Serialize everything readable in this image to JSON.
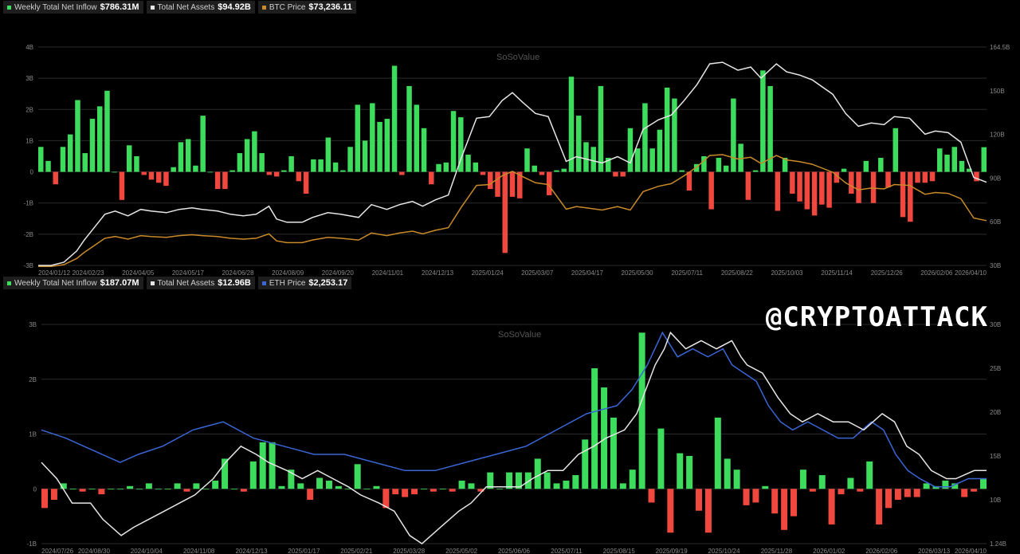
{
  "watermark": "@CRYPTOATTACK",
  "logo": "SoSoValue",
  "colors": {
    "positive": "#3ddc5c",
    "negative": "#f0473f",
    "assets": "#e6e6e6",
    "btc": "#c98a2a",
    "eth": "#3a66d6",
    "grid": "#2a2a2a"
  },
  "chart_data": [
    {
      "type": "bar",
      "legend": [
        {
          "label": "Weekly Total Net Inflow",
          "value": "$786.31M",
          "color": "#3ddc5c"
        },
        {
          "label": "Total Net Assets",
          "value": "$94.92B",
          "color": "#e6e6e6"
        },
        {
          "label": "BTC Price",
          "value": "$73,236.11",
          "color": "#c98a2a"
        }
      ],
      "ylim": [
        -3,
        4
      ],
      "y_ticks": [
        "4B",
        "3B",
        "2B",
        "1B",
        "0",
        "-1B",
        "-2B",
        "-3B"
      ],
      "y2_ticks": [
        "164.5B",
        "150B",
        "120B",
        "90B",
        "60B",
        "30B"
      ],
      "x_ticks": [
        "2024/01/12",
        "2024/02/23",
        "2024/04/05",
        "2024/05/17",
        "2024/06/28",
        "2024/08/09",
        "2024/09/20",
        "2024/11/01",
        "2024/12/13",
        "2025/01/24",
        "2025/03/07",
        "2025/04/17",
        "2025/05/30",
        "2025/07/11",
        "2025/08/22",
        "2025/10/03",
        "2025/11/14",
        "2025/12/26",
        "2026/02/06",
        "2026/04/10"
      ],
      "inflow": [
        0.8,
        0.35,
        -0.4,
        0.8,
        1.2,
        2.3,
        0.6,
        1.7,
        2.1,
        2.6,
        0,
        -0.9,
        0.85,
        0.5,
        -0.1,
        -0.25,
        -0.35,
        -0.45,
        0.15,
        0.95,
        1.05,
        0.2,
        1.8,
        0,
        -0.55,
        -0.55,
        0.05,
        0.6,
        1.05,
        1.3,
        0.6,
        -0.1,
        -0.15,
        0.05,
        0.5,
        -0.3,
        -0.7,
        0.4,
        0.4,
        1.1,
        0.3,
        0.05,
        0.8,
        2.15,
        1,
        2.2,
        1.6,
        1.7,
        3.4,
        -0.1,
        2.75,
        2.15,
        1.4,
        -0.4,
        0.25,
        0.3,
        1.95,
        1.75,
        0.55,
        0.3,
        -0.1,
        -0.55,
        -0.8,
        -2.6,
        -0.8,
        -0.85,
        0.75,
        0.2,
        -0.1,
        -0.75,
        0.05,
        0.1,
        3.05,
        1.8,
        0.95,
        0.8,
        2.75,
        0.45,
        -0.15,
        -0.15,
        1.4,
        0.75,
        2.2,
        0.75,
        1.35,
        2.7,
        2.35,
        0.05,
        -0.6,
        0.25,
        0.5,
        -1.2,
        0.45,
        0.2,
        2.35,
        0.9,
        -0.9,
        0.05,
        3.25,
        2.75,
        -1.25,
        0.45,
        -0.7,
        -0.95,
        -1.2,
        -1.4,
        -1.05,
        -1.15,
        -0.35,
        0.1,
        -0.7,
        -1,
        0.35,
        -1,
        0.45,
        -0.5,
        1.4,
        -1.45,
        -1.6,
        -0.35,
        -0.35,
        -0.3,
        0.75,
        0.55,
        0.8,
        0.35,
        0.1,
        -0.3,
        0.79
      ],
      "assets_pts": [
        [
          0,
          28
        ],
        [
          5,
          28
        ],
        [
          10,
          30
        ],
        [
          15,
          37
        ],
        [
          18,
          44
        ],
        [
          22,
          52
        ],
        [
          26,
          60
        ],
        [
          30,
          62
        ],
        [
          35,
          59
        ],
        [
          40,
          63
        ],
        [
          44,
          62
        ],
        [
          50,
          61
        ],
        [
          55,
          63
        ],
        [
          60,
          64
        ],
        [
          64,
          63
        ],
        [
          70,
          62
        ],
        [
          75,
          60
        ],
        [
          80,
          59
        ],
        [
          85,
          60
        ],
        [
          90,
          65
        ],
        [
          93,
          57
        ],
        [
          97,
          55
        ],
        [
          103,
          55
        ],
        [
          107,
          58
        ],
        [
          113,
          61
        ],
        [
          118,
          60
        ],
        [
          125,
          58
        ],
        [
          130,
          66
        ],
        [
          136,
          63
        ],
        [
          141,
          66
        ],
        [
          146,
          68
        ],
        [
          150,
          65
        ],
        [
          155,
          69
        ],
        [
          160,
          72
        ],
        [
          165,
          95
        ],
        [
          171,
          120
        ],
        [
          176,
          121
        ],
        [
          181,
          131
        ],
        [
          185,
          136
        ],
        [
          189,
          130
        ],
        [
          194,
          123
        ],
        [
          199,
          121
        ],
        [
          206,
          93
        ],
        [
          210,
          96
        ],
        [
          215,
          94
        ],
        [
          220,
          92
        ],
        [
          226,
          96
        ],
        [
          231,
          92
        ],
        [
          236,
          113
        ],
        [
          242,
          119
        ],
        [
          247,
          122
        ],
        [
          252,
          131
        ],
        [
          257,
          141
        ],
        [
          262,
          154
        ],
        [
          267,
          155
        ],
        [
          273,
          150
        ],
        [
          278,
          152
        ],
        [
          282,
          145
        ],
        [
          288,
          154
        ],
        [
          292,
          149
        ],
        [
          297,
          147
        ],
        [
          302,
          144
        ],
        [
          310,
          135
        ],
        [
          315,
          123
        ],
        [
          320,
          115
        ],
        [
          325,
          117
        ],
        [
          330,
          116
        ],
        [
          334,
          121
        ],
        [
          340,
          120
        ],
        [
          346,
          110
        ],
        [
          350,
          112
        ],
        [
          355,
          111
        ],
        [
          360,
          105
        ],
        [
          365,
          83
        ],
        [
          370,
          80
        ]
      ]
    },
    {
      "type": "bar",
      "legend": [
        {
          "label": "Weekly Total Net Inflow",
          "value": "$187.07M",
          "color": "#3ddc5c"
        },
        {
          "label": "Total Net Assets",
          "value": "$12.96B",
          "color": "#e6e6e6"
        },
        {
          "label": "ETH Price",
          "value": "$2,253.17",
          "color": "#3a66d6"
        }
      ],
      "ylim": [
        -1,
        3
      ],
      "y_ticks": [
        "3B",
        "2B",
        "1B",
        "0",
        "-1B"
      ],
      "y2_ticks": [
        "30B",
        "25B",
        "20B",
        "15B",
        "10B",
        "1.24B"
      ],
      "x_ticks": [
        "2024/07/26",
        "2024/08/30",
        "2024/10/04",
        "2024/11/08",
        "2024/12/13",
        "2025/01/17",
        "2025/02/21",
        "2025/03/28",
        "2025/05/02",
        "2025/06/06",
        "2025/07/11",
        "2025/08/15",
        "2025/09/19",
        "2025/10/24",
        "2025/11/28",
        "2026/01/02",
        "2026/02/06",
        "2026/03/13",
        "2026/04/10"
      ],
      "inflow": [
        -0.35,
        -0.2,
        0.1,
        0,
        -0.05,
        0,
        -0.1,
        0,
        0,
        0.05,
        0,
        0.1,
        0,
        0,
        0.1,
        -0.05,
        0.1,
        0,
        0.15,
        0.55,
        0,
        -0.05,
        0.5,
        0.85,
        0.85,
        0.05,
        0.35,
        0.1,
        -0.2,
        0.2,
        0.15,
        0.05,
        0,
        0.45,
        0,
        0.05,
        -0.35,
        -0.1,
        -0.15,
        -0.1,
        0,
        -0.05,
        0,
        -0.05,
        0.15,
        0.1,
        -0.05,
        0.3,
        0,
        0.3,
        0.3,
        0.3,
        0.55,
        0.3,
        0.1,
        0.15,
        0.25,
        0.9,
        2.2,
        1.85,
        1.3,
        0.1,
        0.35,
        2.85,
        -0.25,
        1.1,
        -0.8,
        0.65,
        0.6,
        -0.4,
        -0.8,
        1.3,
        0.55,
        0.35,
        -0.3,
        -0.25,
        0.05,
        -0.45,
        -0.75,
        -0.5,
        0.35,
        -0.05,
        0.25,
        -0.65,
        -0.1,
        0.2,
        -0.05,
        0.5,
        -0.65,
        -0.35,
        -0.2,
        -0.15,
        -0.15,
        0.1,
        0.05,
        0.15,
        0.1,
        -0.15,
        -0.05,
        0.19
      ],
      "assets_pts": [
        [
          0,
          13
        ],
        [
          5,
          11
        ],
        [
          10,
          8
        ],
        [
          16,
          8
        ],
        [
          20,
          6
        ],
        [
          26,
          4
        ],
        [
          30,
          5
        ],
        [
          35,
          6
        ],
        [
          40,
          7
        ],
        [
          45,
          8
        ],
        [
          50,
          9
        ],
        [
          56,
          11
        ],
        [
          60,
          13
        ],
        [
          65,
          15
        ],
        [
          70,
          14
        ],
        [
          74,
          13
        ],
        [
          80,
          12
        ],
        [
          85,
          11
        ],
        [
          90,
          12
        ],
        [
          95,
          11
        ],
        [
          100,
          10
        ],
        [
          104,
          9
        ],
        [
          110,
          8
        ],
        [
          115,
          7
        ],
        [
          120,
          4
        ],
        [
          124,
          3
        ],
        [
          130,
          5
        ],
        [
          136,
          7
        ],
        [
          140,
          8
        ],
        [
          145,
          10
        ],
        [
          150,
          10
        ],
        [
          156,
          10
        ],
        [
          160,
          11
        ],
        [
          165,
          12
        ],
        [
          170,
          12
        ],
        [
          175,
          14
        ],
        [
          180,
          15
        ],
        [
          184,
          16
        ],
        [
          190,
          17
        ],
        [
          194,
          19
        ],
        [
          200,
          25
        ],
        [
          203,
          27
        ],
        [
          205,
          29
        ],
        [
          210,
          27
        ],
        [
          215,
          28
        ],
        [
          220,
          27
        ],
        [
          225,
          28
        ],
        [
          228,
          26
        ],
        [
          230,
          25
        ],
        [
          235,
          24
        ],
        [
          240,
          21
        ],
        [
          244,
          19
        ],
        [
          248,
          18
        ],
        [
          253,
          19
        ],
        [
          258,
          18
        ],
        [
          263,
          18
        ],
        [
          268,
          17
        ],
        [
          274,
          19
        ],
        [
          278,
          18
        ],
        [
          282,
          15
        ],
        [
          286,
          14
        ],
        [
          290,
          12
        ],
        [
          295,
          11
        ],
        [
          298,
          11
        ],
        [
          304,
          12
        ],
        [
          308,
          12
        ]
      ],
      "price_pts": [
        [
          0,
          17
        ],
        [
          8,
          16
        ],
        [
          14,
          15
        ],
        [
          20,
          14
        ],
        [
          26,
          13
        ],
        [
          32,
          14
        ],
        [
          40,
          15
        ],
        [
          50,
          17
        ],
        [
          60,
          18
        ],
        [
          70,
          16
        ],
        [
          80,
          15
        ],
        [
          90,
          14
        ],
        [
          100,
          14
        ],
        [
          110,
          13
        ],
        [
          120,
          12
        ],
        [
          130,
          12
        ],
        [
          140,
          13
        ],
        [
          150,
          14
        ],
        [
          160,
          15
        ],
        [
          170,
          17
        ],
        [
          180,
          19
        ],
        [
          190,
          20
        ],
        [
          195,
          22
        ],
        [
          200,
          25
        ],
        [
          205,
          29
        ],
        [
          210,
          26
        ],
        [
          215,
          27
        ],
        [
          220,
          26
        ],
        [
          225,
          27
        ],
        [
          228,
          25
        ],
        [
          232,
          24
        ],
        [
          236,
          23
        ],
        [
          240,
          20
        ],
        [
          244,
          18
        ],
        [
          248,
          17
        ],
        [
          253,
          18
        ],
        [
          258,
          17
        ],
        [
          263,
          16
        ],
        [
          268,
          16
        ],
        [
          274,
          18
        ],
        [
          278,
          17
        ],
        [
          282,
          14
        ],
        [
          286,
          12
        ],
        [
          290,
          11
        ],
        [
          295,
          10
        ],
        [
          300,
          10
        ],
        [
          306,
          11
        ],
        [
          312,
          11
        ]
      ]
    }
  ]
}
